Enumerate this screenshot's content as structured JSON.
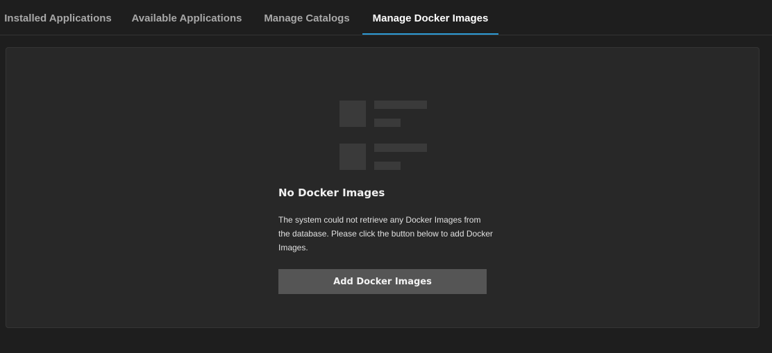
{
  "tabs": [
    {
      "label": "Installed Applications",
      "active": false
    },
    {
      "label": "Available Applications",
      "active": false
    },
    {
      "label": "Manage Catalogs",
      "active": false
    },
    {
      "label": "Manage Docker Images",
      "active": true
    }
  ],
  "empty_state": {
    "icon": "list-placeholder-icon",
    "title": "No Docker Images",
    "message": "The system could not retrieve any Docker Images from the database. Please click the button below to add Docker Images.",
    "button_label": "Add Docker Images"
  },
  "colors": {
    "background": "#1e1e1e",
    "panel": "#282828",
    "accent": "#2d9bd6",
    "button": "#555555",
    "icon": "#3a3a3a"
  }
}
